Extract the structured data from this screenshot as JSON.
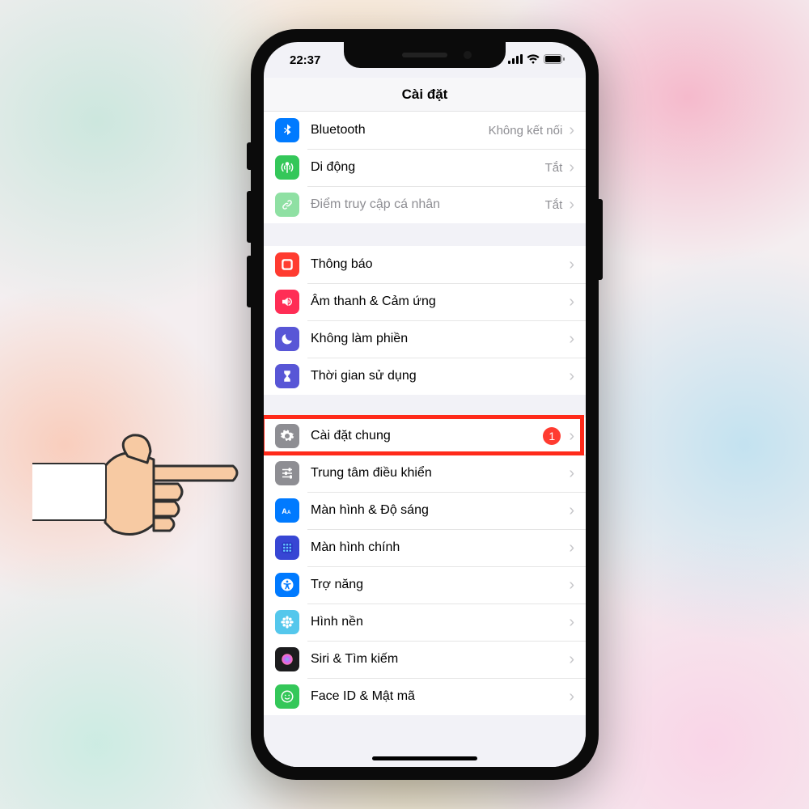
{
  "status": {
    "time": "22:37"
  },
  "header": {
    "title": "Cài đặt"
  },
  "groups": [
    {
      "rows": [
        {
          "id": "bluetooth",
          "label": "Bluetooth",
          "value": "Không kết nối",
          "icon": "bluetooth",
          "color": "#007aff"
        },
        {
          "id": "cellular",
          "label": "Di động",
          "value": "Tắt",
          "icon": "antenna",
          "color": "#34c759"
        },
        {
          "id": "hotspot",
          "label": "Điểm truy cập cá nhân",
          "value": "Tắt",
          "icon": "link",
          "color": "#34c759",
          "dim": true
        }
      ]
    },
    {
      "rows": [
        {
          "id": "notifications",
          "label": "Thông báo",
          "icon": "bell-square",
          "color": "#ff3b30"
        },
        {
          "id": "sounds",
          "label": "Âm thanh & Cảm ứng",
          "icon": "speaker",
          "color": "#ff2d55"
        },
        {
          "id": "dnd",
          "label": "Không làm phiền",
          "icon": "moon",
          "color": "#5856d6"
        },
        {
          "id": "screentime",
          "label": "Thời gian sử dụng",
          "icon": "hourglass",
          "color": "#5856d6"
        }
      ]
    },
    {
      "rows": [
        {
          "id": "general",
          "label": "Cài đặt chung",
          "icon": "gear",
          "color": "#8e8e93",
          "badge": "1",
          "highlight": true
        },
        {
          "id": "controlcenter",
          "label": "Trung tâm điều khiển",
          "icon": "sliders",
          "color": "#8e8e93"
        },
        {
          "id": "display",
          "label": "Màn hình & Độ sáng",
          "icon": "text-size",
          "color": "#007aff"
        },
        {
          "id": "homescreen",
          "label": "Màn hình chính",
          "icon": "app-grid",
          "color": "#3746d4"
        },
        {
          "id": "accessibility",
          "label": "Trợ năng",
          "icon": "accessibility",
          "color": "#007aff"
        },
        {
          "id": "wallpaper",
          "label": "Hình nền",
          "icon": "flower",
          "color": "#54c7ec"
        },
        {
          "id": "siri",
          "label": "Siri & Tìm kiếm",
          "icon": "siri",
          "color": "#1c1c1e"
        },
        {
          "id": "faceid",
          "label": "Face ID & Mật mã",
          "icon": "face",
          "color": "#34c759"
        }
      ]
    }
  ]
}
